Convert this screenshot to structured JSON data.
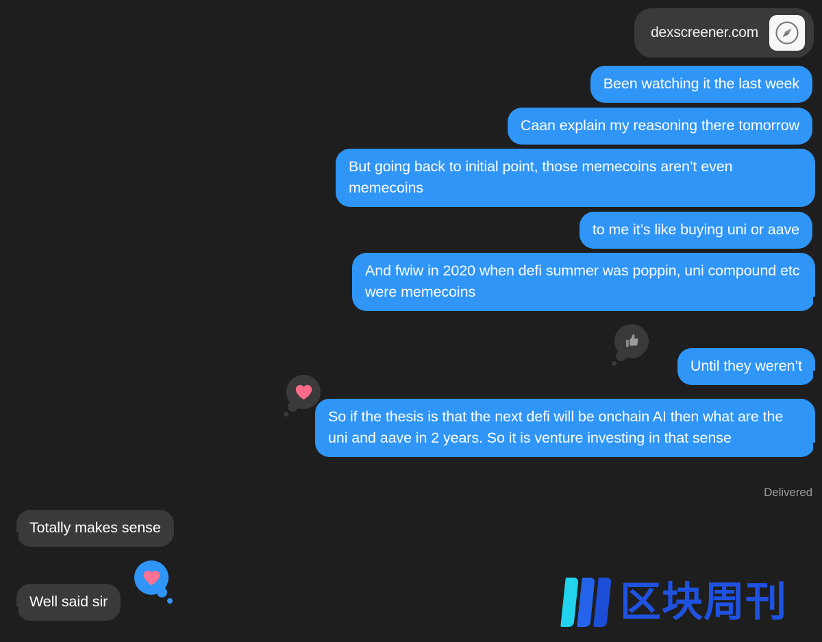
{
  "app": {
    "name": "Messages",
    "theme": "dark",
    "background_color": "#1e1e1e",
    "sent_bubble_color": "#2f95f7",
    "received_bubble_color": "#3a3a3c"
  },
  "link_preview": {
    "url": "dexscreener.com",
    "icon": "safari-compass-icon"
  },
  "messages": [
    {
      "id": "m1",
      "side": "sent",
      "text": "Been watching it the last week"
    },
    {
      "id": "m2",
      "side": "sent",
      "text": "Caan explain my reasoning there tomorrow"
    },
    {
      "id": "m3",
      "side": "sent",
      "text": "But going back to initial point, those memecoins aren’t even memecoins"
    },
    {
      "id": "m4",
      "side": "sent",
      "text": "to me it’s like buying uni or aave"
    },
    {
      "id": "m5",
      "side": "sent",
      "text": "And fwiw in 2020 when defi summer was poppin, uni compound etc were memecoins"
    },
    {
      "id": "m6",
      "side": "sent",
      "text": "Until they weren’t"
    },
    {
      "id": "m7",
      "side": "sent",
      "text": "So if the thesis is that the next defi will be onchain AI then what are the uni and aave in 2 years. So it is venture investing in that sense"
    },
    {
      "id": "m8",
      "side": "received",
      "text": "Totally makes sense"
    },
    {
      "id": "m9",
      "side": "received",
      "text": "Well said sir"
    }
  ],
  "reactions": [
    {
      "id": "r1",
      "on_message": "m6",
      "type": "thumbs-up",
      "style": "received",
      "bubble_color": "#3a3a3c",
      "glyph_color": "#8e8e93"
    },
    {
      "id": "r2",
      "on_message": "m7",
      "type": "heart",
      "style": "received",
      "bubble_color": "#3a3a3c",
      "glyph_color": "#ff6b8a"
    },
    {
      "id": "r3",
      "on_message": "m9",
      "type": "heart",
      "style": "sent",
      "bubble_color": "#2f95f7",
      "glyph_color": "#ff6b8a"
    }
  ],
  "status": {
    "delivered_label": "Delivered"
  },
  "watermark": {
    "text": "区块周刊",
    "bar_colors": [
      "#22d3ee",
      "#2563eb",
      "#1d4ed8"
    ],
    "text_color": "#1f52e0"
  }
}
